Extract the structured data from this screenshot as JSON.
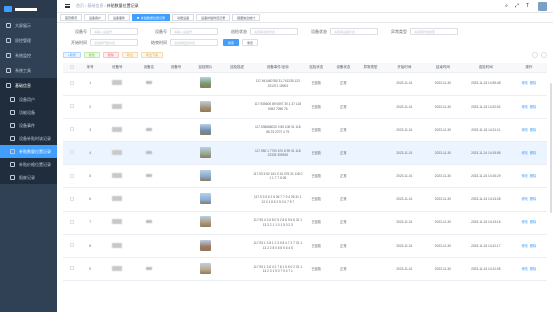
{
  "sidebar": {
    "items": [
      {
        "label": "大屏展示",
        "icon": "monitor-icon"
      },
      {
        "label": "质控管理",
        "icon": "document-icon"
      },
      {
        "label": "系统监控",
        "icon": "chart-icon"
      },
      {
        "label": "系统工具",
        "icon": "tool-icon"
      },
      {
        "label": "基础信息",
        "icon": "setting-icon",
        "open": true
      }
    ],
    "sub": [
      {
        "label": "设备用户"
      },
      {
        "label": "功能设备"
      },
      {
        "label": "设备事件"
      },
      {
        "label": "设备补贴时该记录"
      },
      {
        "label": "补贴数量位置记录",
        "active": true
      },
      {
        "label": "补贴价格位置记录"
      },
      {
        "label": "报废记录"
      }
    ]
  },
  "header": {
    "home": "首页",
    "crumb1": "基础信息",
    "crumb2": "补贴数量位置记录"
  },
  "tabs": [
    "首页概况",
    "设备用户",
    "设备事件",
    "补贴数量位置记录",
    "功能设备",
    "设备补贴时该记录",
    "报废信息统计"
  ],
  "filters": {
    "row1": [
      {
        "label": "设备号",
        "placeholder": "请输入设备号"
      },
      {
        "label": "设备号",
        "placeholder": "请输入设备号"
      },
      {
        "label": "巡检状态",
        "placeholder": "请选择巡检状态"
      },
      {
        "label": "设备状态",
        "placeholder": "请选择设备状态"
      },
      {
        "label": "异常类型",
        "placeholder": "请选择异常类型"
      }
    ],
    "row2": [
      {
        "label": "开始时间",
        "placeholder": "请选择开始时间"
      },
      {
        "label": "结束时间",
        "placeholder": "请选择结束时间"
      }
    ],
    "search": "搜索",
    "reset": "重置"
  },
  "ops": {
    "add": "+新增",
    "edit": "修改",
    "del": "删除",
    "export": "导出",
    "import": "导出下载"
  },
  "columns": [
    "序号",
    "设备号",
    "设备名",
    "设备号",
    "巡检照片",
    "巡检描述",
    "设备事件/坐标",
    "巡检状态",
    "设备状态",
    "异常类型",
    "开始时间",
    "结束时间",
    "巡检时间",
    "操作"
  ],
  "rows": [
    {
      "no": "1",
      "coord": "117.941460780 31.741235 123 221371 15903",
      "insp": "已巡检",
      "status": "正常",
      "start": "2023-11-01",
      "end": "2023-11-30",
      "time": "2023-11-24 14:35:48",
      "color": "#7a9a6a",
      "hl": false
    },
    {
      "no": "2",
      "coord": "117.935600 89 0597 30.1 37 118 9052 7096 76",
      "insp": "已巡检",
      "status": "正常",
      "start": "2023-11-01",
      "end": "2023-11-30",
      "time": "2023-11-24 14:22:52",
      "color": "#a89070",
      "hl": false
    },
    {
      "no": "3",
      "coord": "117.935686020 0 85 108 31 118 86 23 2707 4 79",
      "insp": "已巡检",
      "status": "正常",
      "start": "2023-11-01",
      "end": "2023-11-30",
      "time": "2023-11-24 14:21:11",
      "color": "#6b8fb0",
      "hl": false
    },
    {
      "no": "4",
      "coord": "117.950 1 7700 670 8 99 31 118 22325 359945",
      "insp": "已巡检",
      "status": "正常",
      "start": "2023-11-01",
      "end": "2023-11-30",
      "time": "2023-11-24 14:15:58",
      "color": "#9aa890",
      "hl": true
    },
    {
      "no": "5",
      "coord": "117.93 5 52 161 0 15 076 31 118 0 1 1 7 7 5 08",
      "insp": "已巡检",
      "status": "正常",
      "start": "2023-11-01",
      "end": "2023-11-30",
      "time": "2023-11-24 14:15:29",
      "color": "#88a8c8",
      "hl": false
    },
    {
      "no": "6",
      "coord": "117.9 3 5 5 2 6 06 7 7 9 4 05 31 1 13 3 1 8 5 2 5 0 0 7 5 7",
      "insp": "已巡检",
      "status": "正常",
      "start": "2023-11-01",
      "end": "2023-11-30",
      "time": "2023-11-24 14:13:28",
      "color": "#8ab0d8",
      "hl": false
    },
    {
      "no": "7",
      "coord": "117.93 4 2 6 8 0 9 2 8 6 9 6 6 31 1 13 3 2 1 1 0 1 5 0 2 3",
      "insp": "已巡检",
      "status": "正常",
      "start": "2023-11-01",
      "end": "2023-11-30",
      "time": "2023-11-24 14:13:16",
      "color": "#b09878",
      "hl": false
    },
    {
      "no": "8",
      "coord": "117.93 1 3 8 1 2 3 0 8 4 7 2 7 31 1 13 2 2 8 0 5 8 5 6 4 5",
      "insp": "已巡检",
      "status": "正常",
      "start": "2023-11-01",
      "end": "2023-11-30",
      "time": "2023-11-24 14:12:17",
      "color": "#a07860",
      "hl": false
    },
    {
      "no": "9",
      "coord": "117.93 1 3 8 4 2 7 8 1 5 5 0 2 31 1 14 2 3 1 9 0 7 9 4 7 1",
      "insp": "已巡检",
      "status": "正常",
      "start": "2023-11-01",
      "end": "2023-11-30",
      "time": "2023-11-24 14:12:05",
      "color": "#c0a888",
      "hl": false
    }
  ],
  "row_actions": {
    "edit": "修改",
    "del": "删除"
  }
}
